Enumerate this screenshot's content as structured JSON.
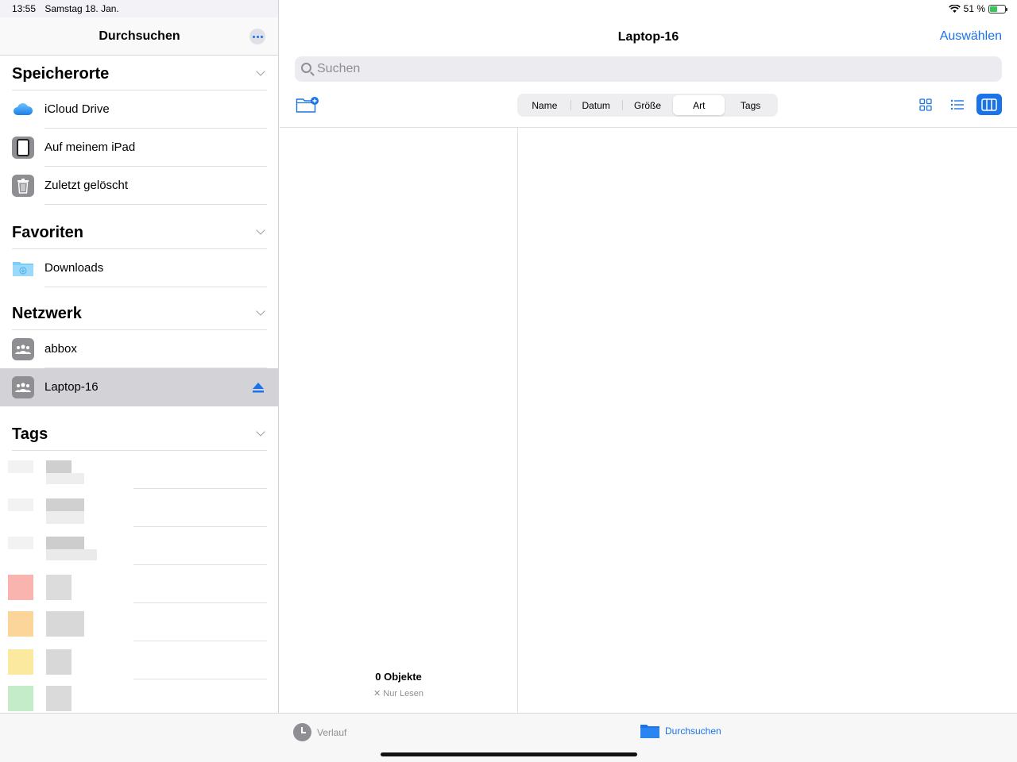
{
  "status": {
    "time": "13:55",
    "date": "Samstag 18. Jan.",
    "battery": "51 %",
    "battery_level": 0.51
  },
  "sidebar": {
    "title": "Durchsuchen",
    "sections": {
      "locations": {
        "title": "Speicherorte",
        "items": [
          {
            "label": "iCloud Drive",
            "icon": "icloud-icon"
          },
          {
            "label": "Auf meinem iPad",
            "icon": "ipad-icon"
          },
          {
            "label": "Zuletzt gelöscht",
            "icon": "trash-icon"
          }
        ]
      },
      "favorites": {
        "title": "Favoriten",
        "items": [
          {
            "label": "Downloads",
            "icon": "downloads-folder-icon"
          }
        ]
      },
      "network": {
        "title": "Netzwerk",
        "items": [
          {
            "label": "abbox",
            "icon": "network-share-icon"
          },
          {
            "label": "Laptop-16",
            "icon": "network-share-icon",
            "selected": true
          }
        ]
      },
      "tags": {
        "title": "Tags"
      }
    }
  },
  "main": {
    "title": "Laptop-16",
    "select_label": "Auswählen",
    "search_placeholder": "Suchen",
    "sort_options": [
      "Name",
      "Datum",
      "Größe",
      "Art",
      "Tags"
    ],
    "active_sort": "Art",
    "view_modes": [
      "grid",
      "list",
      "columns"
    ],
    "active_view": "columns",
    "item_count": "0 Objekte",
    "readonly_label": "Nur Lesen"
  },
  "tabbar": {
    "history_label": "Verlauf",
    "browse_label": "Durchsuchen"
  },
  "colors": {
    "accent": "#1a73e8",
    "selected_row": "#d2d2d7"
  }
}
